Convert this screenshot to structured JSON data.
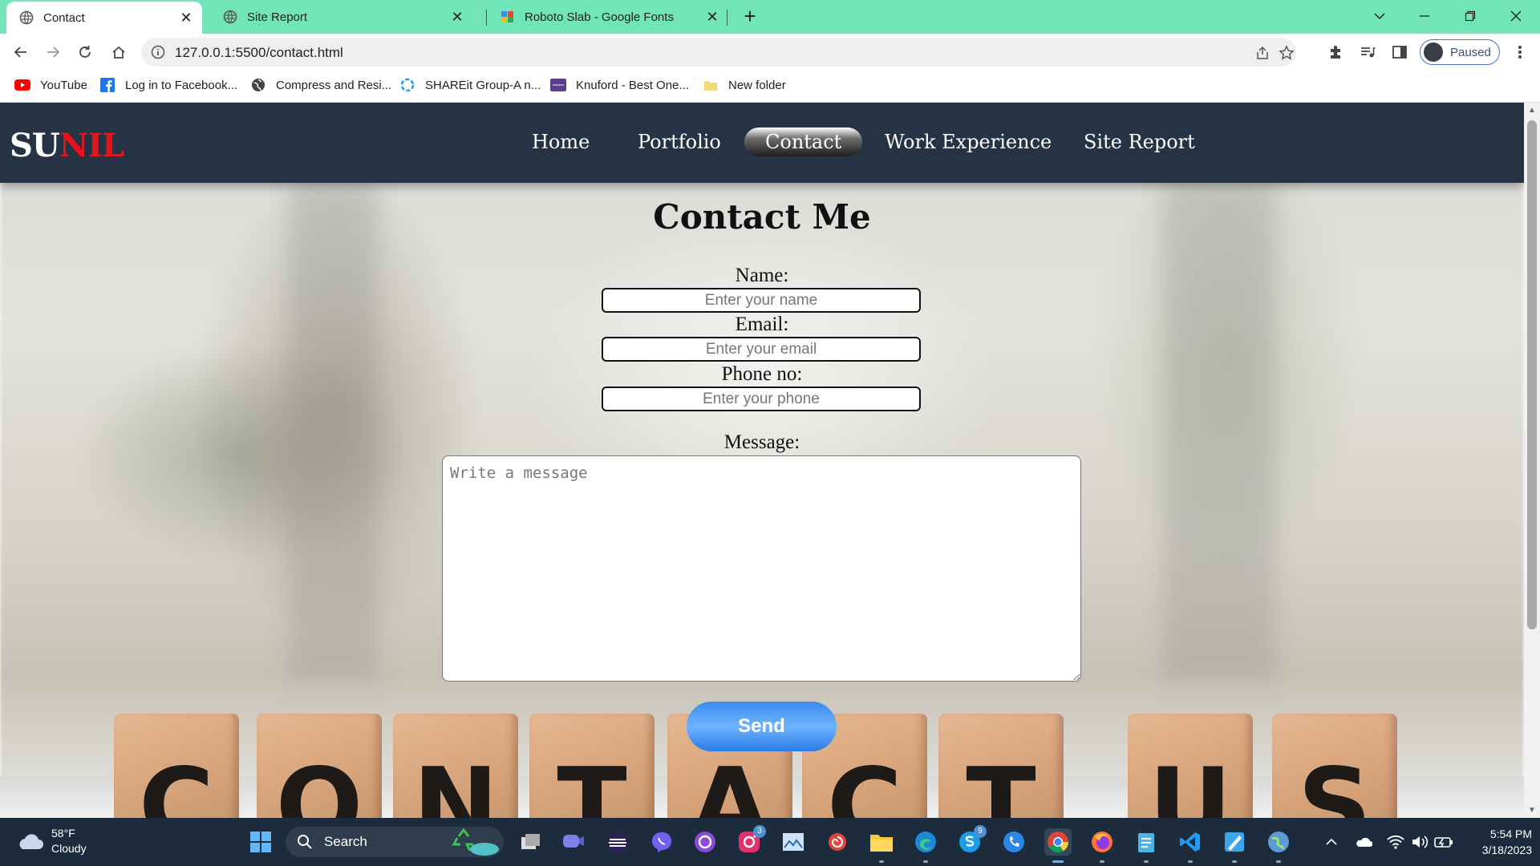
{
  "browser": {
    "tabs": [
      {
        "label": "Contact",
        "active": true
      },
      {
        "label": "Site Report",
        "active": false
      },
      {
        "label": "Roboto Slab - Google Fonts",
        "active": false
      }
    ],
    "url": "127.0.0.1:5500/contact.html",
    "profile_label": "Paused",
    "bookmarks": [
      {
        "label": "YouTube",
        "icon": "youtube-icon"
      },
      {
        "label": "Log in to Facebook...",
        "icon": "facebook-icon"
      },
      {
        "label": "Compress and Resi...",
        "icon": "globe-icon"
      },
      {
        "label": "SHAREit Group-A n...",
        "icon": "shareit-icon"
      },
      {
        "label": "Knuford - Best One...",
        "icon": "knuford-icon"
      },
      {
        "label": "New folder",
        "icon": "folder-icon"
      }
    ]
  },
  "site": {
    "logo_part1": "SU",
    "logo_part2": "NIL",
    "nav": [
      {
        "label": "Home",
        "active": false
      },
      {
        "label": "Portfolio",
        "active": false
      },
      {
        "label": "Contact",
        "active": true
      },
      {
        "label": "Work Experience",
        "active": false
      },
      {
        "label": "Site Report",
        "active": false
      }
    ]
  },
  "contact": {
    "title": "Contact Me",
    "name_label": "Name:",
    "name_placeholder": "Enter your name",
    "email_label": "Email:",
    "email_placeholder": "Enter your email",
    "phone_label": "Phone no:",
    "phone_placeholder": "Enter your phone",
    "message_label": "Message:",
    "message_placeholder": "Write a message",
    "send_label": "Send"
  },
  "background": {
    "cube_letters": [
      "C",
      "O",
      "N",
      "T",
      "A",
      "C",
      "T",
      "U",
      "S"
    ]
  },
  "taskbar": {
    "weather_temp": "58°F",
    "weather_desc": "Cloudy",
    "search_label": "Search",
    "instagram_badge": "3",
    "skype_badge": "9",
    "time": "5:54 PM",
    "date": "3/18/2023"
  },
  "colors": {
    "tabstrip": "#72e5b8",
    "site_nav": "#253344",
    "logo_accent": "#e8121b",
    "send_button": "#3a8bf0",
    "taskbar": "#1c2c3c"
  }
}
